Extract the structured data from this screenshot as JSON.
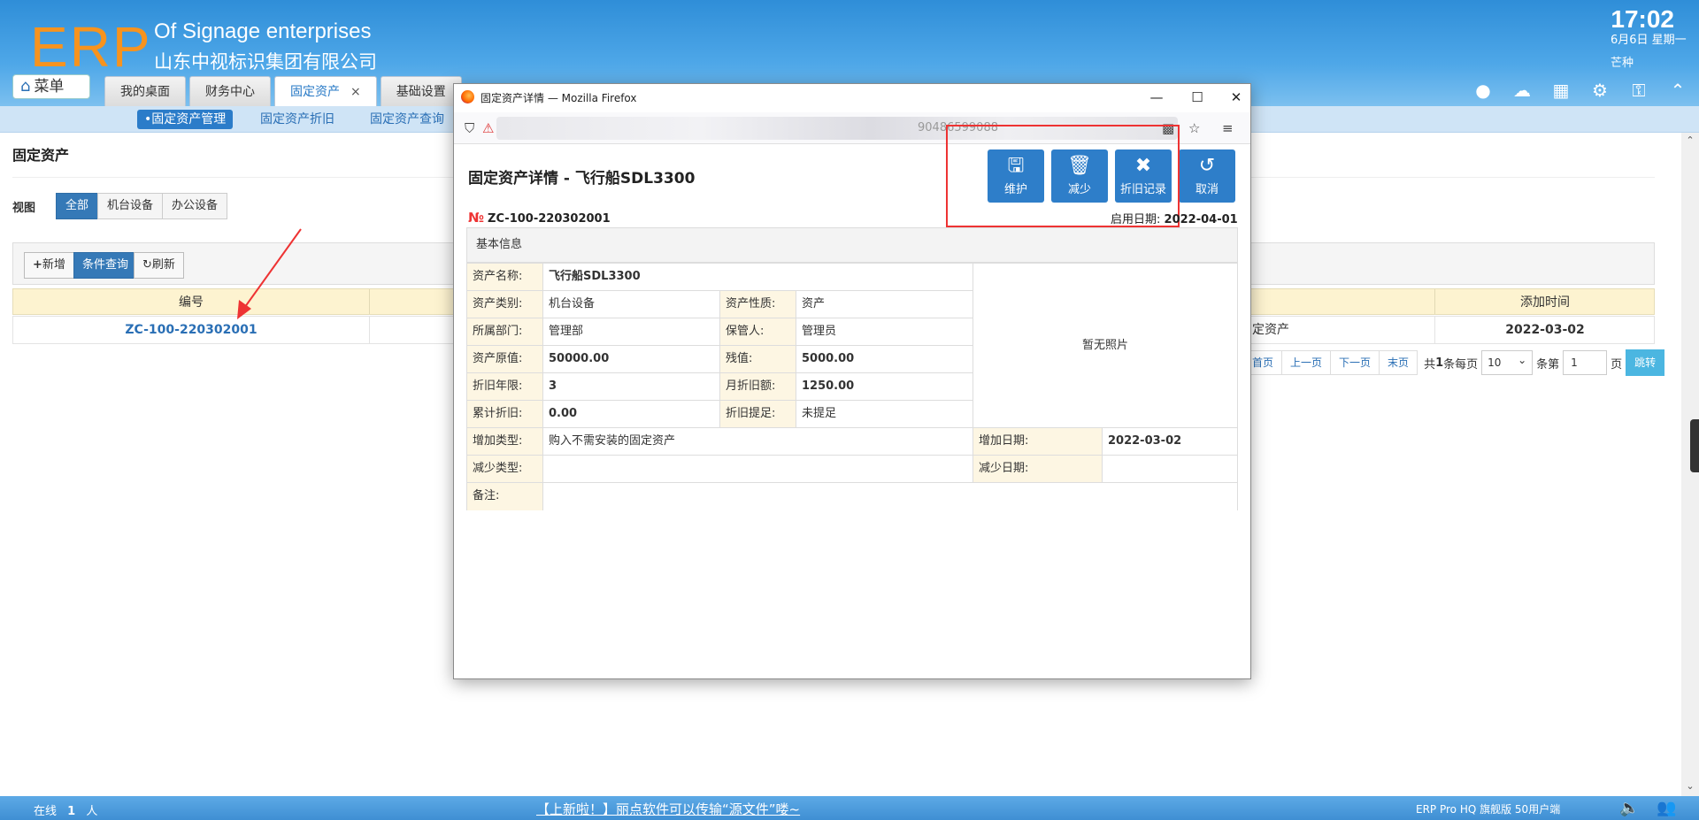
{
  "header": {
    "logo": "ERP",
    "company_en": "Of Signage enterprises",
    "company_cn": "山东中视标识集团有限公司",
    "clock": "17:02",
    "date": "6月6日 星期一",
    "holiday": "芒种"
  },
  "menu": {
    "label": "菜单"
  },
  "tabs": [
    {
      "label": "我的桌面"
    },
    {
      "label": "财务中心"
    },
    {
      "label": "固定资产",
      "close": "×"
    },
    {
      "label": "基础设置"
    }
  ],
  "subnav": [
    {
      "label": "•固定资产管理"
    },
    {
      "label": "固定资产折旧"
    },
    {
      "label": "固定资产查询"
    }
  ],
  "page": {
    "title": "固定资产",
    "view_label": "视图",
    "views": [
      "全部",
      "机台设备",
      "办公设备"
    ],
    "toolbar": {
      "add": "新增",
      "query": "条件查询",
      "refresh": "刷新"
    },
    "table": {
      "headers": {
        "code": "编号",
        "added": "添加时间"
      },
      "row": {
        "code": "ZC-100-220302001",
        "type_partial": "定资产",
        "added": "2022-03-02"
      }
    },
    "pager": {
      "first": "首页",
      "prev": "上一页",
      "next": "下一页",
      "last": "末页",
      "total_prefix": "共",
      "total_count": "1",
      "per_page_text": "条每页",
      "page_size": "10",
      "page_prefix": "条第",
      "page_num": "1",
      "page_suffix": "页",
      "go": "跳转"
    }
  },
  "footer": {
    "online_prefix": "在线",
    "online_count": "1",
    "online_suffix": "人",
    "notice": "【上新啦！】丽点软件可以传输“源文件”喽~",
    "edition": "ERP Pro HQ 旗舰版 50用户端"
  },
  "firefox": {
    "title": "固定资产详情 — Mozilla Firefox",
    "url_tail": "90486599088"
  },
  "detail": {
    "title": "固定资产详情 - 飞行船SDL3300",
    "buttons": {
      "maintain": "维护",
      "reduce": "减少",
      "depreciation": "折旧记录",
      "cancel": "取消"
    },
    "no_symbol": "№",
    "no": "ZC-100-220302001",
    "start_date_label": "启用日期:",
    "start_date": "2022-04-01",
    "section": "基本信息",
    "photo": "暂无照片",
    "fields": {
      "name_label": "资产名称:",
      "name": "飞行船SDL3300",
      "category_label": "资产类别:",
      "category": "机台设备",
      "nature_label": "资产性质:",
      "nature": "资产",
      "dept_label": "所属部门:",
      "dept": "管理部",
      "keeper_label": "保管人:",
      "keeper": "管理员",
      "original_label": "资产原值:",
      "original": "50000.00",
      "residual_label": "残值:",
      "residual": "5000.00",
      "years_label": "折旧年限:",
      "years": "3",
      "monthly_label": "月折旧额:",
      "monthly": "1250.00",
      "accum_label": "累计折旧:",
      "accum": "0.00",
      "provision_label": "折旧提足:",
      "provision": "未提足",
      "add_type_label": "增加类型:",
      "add_type": "购入不需安装的固定资产",
      "add_date_label": "增加日期:",
      "add_date": "2022-03-02",
      "reduce_type_label": "减少类型:",
      "reduce_type": "",
      "reduce_date_label": "减少日期:",
      "reduce_date": "",
      "remark_label": "备注:",
      "remark": ""
    }
  },
  "colors": {
    "header_blue": "#3f97dd",
    "logo_orange": "#f7931e",
    "action_blue": "#2e7ec9",
    "highlight_red": "#ee3333"
  }
}
